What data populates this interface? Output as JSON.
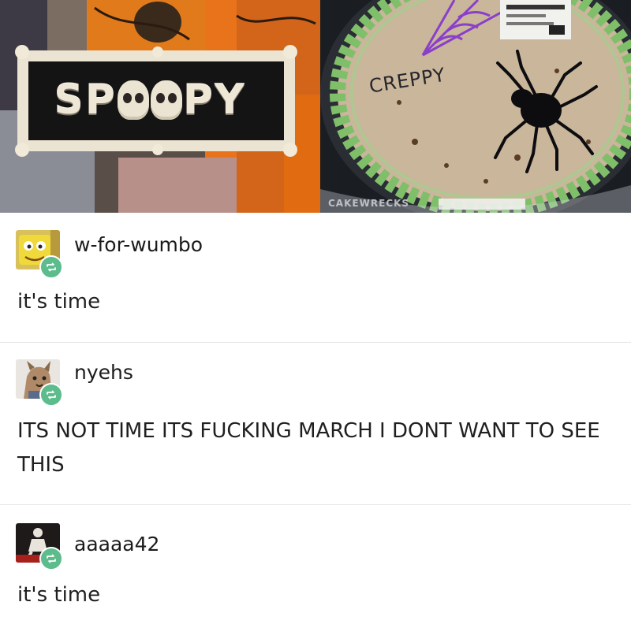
{
  "photos": {
    "left": {
      "sign_text_before": "SP",
      "sign_text_after": "PY",
      "skull_icon": "skull-icon"
    },
    "right": {
      "cake_text": "CREPPY",
      "brand_text": "CAKEWRECKS"
    }
  },
  "posts": [
    {
      "username": "w-for-wumbo",
      "body": "it's time",
      "avatar_icon": "yellow-face-avatar",
      "badge_icon": "reblog-icon"
    },
    {
      "username": "nyehs",
      "body": "ITS NOT TIME ITS FUCKING MARCH I DONT WANT TO SEE THIS",
      "avatar_icon": "dog-character-avatar",
      "badge_icon": "reblog-icon"
    },
    {
      "username": "aaaaa42",
      "body": "it's time",
      "avatar_icon": "dark-figure-avatar",
      "badge_icon": "reblog-icon"
    }
  ],
  "colors": {
    "badge": "#5cbc8c",
    "divider": "#e6e6e6",
    "frosting": "#7fbf6a",
    "spiderweb": "#8a3fc9"
  }
}
